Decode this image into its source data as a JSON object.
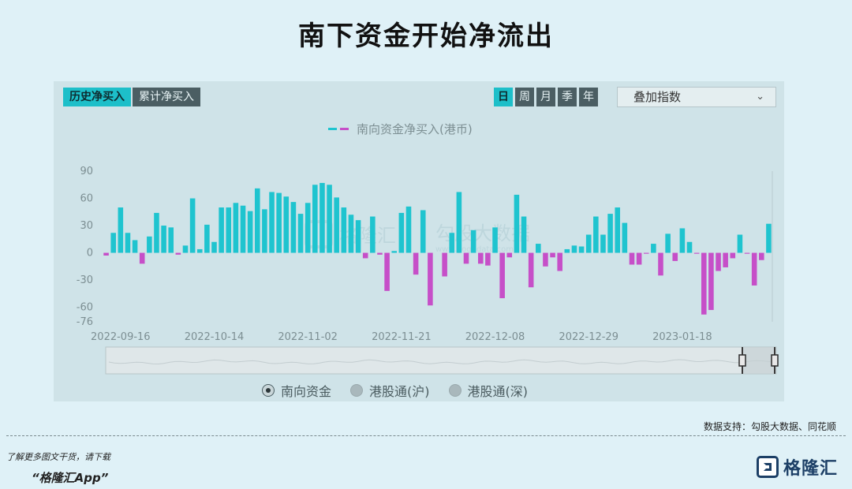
{
  "title": "南下资金开始净流出",
  "tabs": [
    {
      "label": "历史净买入",
      "active": true
    },
    {
      "label": "累计净买入",
      "active": false
    }
  ],
  "periods": [
    {
      "label": "日",
      "active": true
    },
    {
      "label": "周",
      "active": false
    },
    {
      "label": "月",
      "active": false
    },
    {
      "label": "季",
      "active": false
    },
    {
      "label": "年",
      "active": false
    }
  ],
  "overlay_select": {
    "value": "叠加指数"
  },
  "watermark": {
    "brand": "格隆汇",
    "data": "勾股大数据",
    "url": "www.gogudata.com"
  },
  "bottom_legend": [
    {
      "label": "南向资金",
      "selected": true
    },
    {
      "label": "港股通(沪)",
      "selected": false
    },
    {
      "label": "港股通(深)",
      "selected": false
    }
  ],
  "source": "数据支持：勾股大数据、同花顺",
  "footer": {
    "note": "了解更多图文干货，请下载",
    "app": "“格隆汇App”",
    "brand": "格隆汇"
  },
  "colors": {
    "positive": "#1fc4cf",
    "negative": "#c64fc8",
    "panel": "#cfe3e8",
    "background": "#dff1f7"
  },
  "chart_data": {
    "type": "bar",
    "legend": "南向资金净买入(港币)",
    "ylim": [
      -76,
      90
    ],
    "yticks": [
      90,
      60,
      30,
      0,
      -30,
      -60,
      -76
    ],
    "xtick_labels": [
      {
        "label": "2022-09-16",
        "index": 2
      },
      {
        "label": "2022-10-14",
        "index": 15
      },
      {
        "label": "2022-11-02",
        "index": 28
      },
      {
        "label": "2022-11-21",
        "index": 41
      },
      {
        "label": "2022-12-08",
        "index": 54
      },
      {
        "label": "2022-12-29",
        "index": 67
      },
      {
        "label": "2023-01-18",
        "index": 80
      }
    ],
    "values": [
      -3,
      22,
      50,
      22,
      14,
      -12,
      18,
      44,
      30,
      28,
      -2,
      8,
      60,
      4,
      31,
      12,
      50,
      50,
      55,
      52,
      46,
      71,
      48,
      67,
      66,
      62,
      56,
      43,
      55,
      75,
      77,
      75,
      61,
      50,
      42,
      36,
      -6,
      40,
      -2,
      -42,
      2,
      44,
      51,
      -24,
      47,
      -58,
      0,
      -26,
      22,
      67,
      -12,
      25,
      -12,
      -14,
      28,
      -50,
      -5,
      64,
      40,
      -38,
      10,
      -15,
      -5,
      -20,
      4,
      8,
      7,
      20,
      40,
      20,
      43,
      50,
      33,
      -13,
      -13,
      -1,
      10,
      -25,
      21,
      -9,
      27,
      12,
      -1,
      -68,
      -63,
      -20,
      -16,
      -6,
      20,
      -1,
      -36,
      -8,
      32
    ]
  }
}
